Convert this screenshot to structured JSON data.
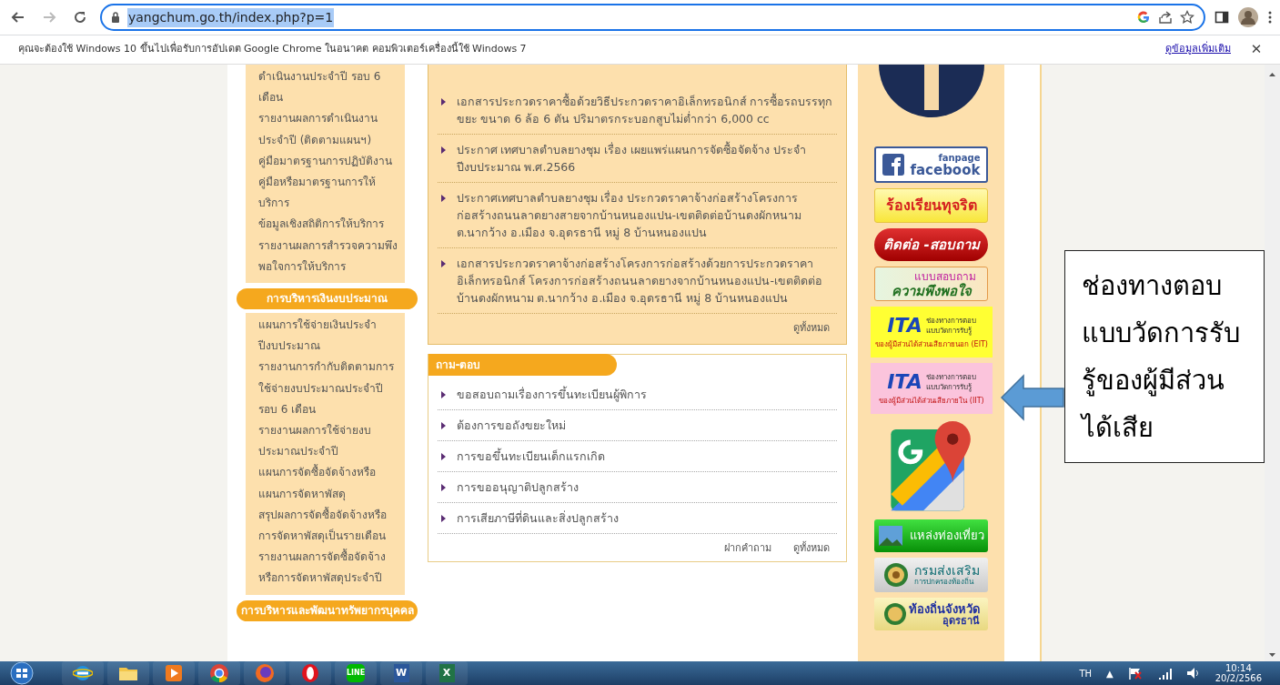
{
  "browser": {
    "back_disabled": false,
    "forward_disabled": true,
    "url": "yangchum.go.th/index.php?p=1",
    "url_selected": true
  },
  "infobar": {
    "message": "คุณจะต้องใช้ Windows 10 ขึ้นไปเพื่อรับการอัปเดต Google Chrome ในอนาคต คอมพิวเตอร์เครื่องนี้ใช้ Windows 7",
    "link": "ดูข้อมูลเพิ่มเติม",
    "close": "✕"
  },
  "left_menu": [
    {
      "items": [
        "ดำเนินงานประจำปี รอบ 6 เดือน",
        "รายงานผลการดำเนินงานประจำปี (ติดตามแผนฯ)",
        "คู่มือมาตรฐานการปฏิบัติงาน",
        "คู่มือหรือมาตรฐานการให้บริการ",
        "ข้อมูลเชิงสถิติการให้บริการ",
        "รายงานผลการสำรวจความพึงพอใจการให้บริการ"
      ]
    },
    {
      "heading": "การบริหารเงินงบประมาณ",
      "items": [
        "แผนการใช้จ่ายเงินประจำปีงบประมาณ",
        "รายงานการกำกับติดตามการใช้จ่ายงบประมาณประจำปี รอบ 6 เดือน",
        "รายงานผลการใช้จ่ายงบประมาณประจำปี",
        "แผนการจัดซื้อจัดจ้างหรือแผนการจัดหาพัสดุ",
        "สรุปผลการจัดซื้อจัดจ้างหรือการจัดหาพัสดุเป็นรายเดือน",
        "รายงานผลการจัดซื้อจัดจ้างหรือการจัดหาพัสดุประจำปี"
      ]
    },
    {
      "heading": "การบริหารและพัฒนาทรัพยากรบุคคล"
    }
  ],
  "news": {
    "items": [
      "เอกสารประกวดราคาซื้อด้วยวิธีประกวดราคาอิเล็กทรอนิกส์ การซื้อรถบรรทุกขยะ ขนาด 6 ล้อ 6 ตัน ปริมาตรกระบอกสูบไม่ต่ำกว่า 6,000 cc",
      "ประกาศ เทศบาลตำบลยางชุม เรื่อง เผยแพร่แผนการจัดซื้อจัดจ้าง ประจำปีงบประมาณ พ.ศ.2566",
      "ประกาศเทศบาลตำบลยางชุม เรื่อง ประกวดราคาจ้างก่อสร้างโครงการก่อสร้างถนนลาดยางสายจากบ้านหนองแปน-เขตติดต่อบ้านดงผักหนาม ต.นากว้าง อ.เมือง จ.อุดรธานี หมู่ 8 บ้านหนองแปน",
      "เอกสารประกวดราคาจ้างก่อสร้างโครงการก่อสร้างด้วยการประกวดราคาอิเล็กทรอนิกส์ โครงการก่อสร้างถนนลาดยางจากบ้านหนองแปน-เขตติดต่อบ้านดงผักหนาม ต.นากว้าง อ.เมือง จ.อุดรธานี หมู่ 8 บ้านหนองแปน"
    ],
    "view_all": "ดูทั้งหมด"
  },
  "qa": {
    "title": "ถาม-ตอบ",
    "items": [
      "ขอสอบถามเรื่องการขึ้นทะเบียนผู้พิการ",
      "ต้องการขอถังขยะใหม่",
      "การขอขึ้นทะเบียนเด็กแรกเกิด",
      "การขออนุญาติปลูกสร้าง",
      "การเสียภาษีที่ดินและสิ่งปลูกสร้าง"
    ],
    "ask": "ฝากคำถาม",
    "view_all": "ดูทั้งหมด"
  },
  "banners": [
    {
      "kind": "fb-circle"
    },
    {
      "kind": "fanpage",
      "lines": [
        "fanpage",
        "facebook"
      ]
    },
    {
      "kind": "report",
      "lines": [
        "ร้องเรียนทุจริต"
      ]
    },
    {
      "kind": "contact",
      "lines": [
        "ติดต่อ -สอบถาม"
      ]
    },
    {
      "kind": "survey",
      "lines": [
        "แบบสอบถาม",
        "ความพึงพอใจ"
      ]
    },
    {
      "kind": "ita",
      "color": "#ffff33",
      "logo": "ITA",
      "lines": [
        "ช่องทางการตอบ",
        "แบบวัดการรับรู้",
        "ของผู้มีส่วนได้ส่วนเสียภายนอก (EIT)"
      ]
    },
    {
      "kind": "ita",
      "color": "#fbc4dc",
      "logo": "ITA",
      "lines": [
        "ช่องทางการตอบ",
        "แบบวัดการรับรู้",
        "ของผู้มีส่วนได้ส่วนเสียภายใน (IIT)"
      ]
    },
    {
      "kind": "maps"
    },
    {
      "kind": "tourism",
      "lines": [
        "แหล่งท่องเที่ยว"
      ]
    },
    {
      "kind": "dept",
      "lines": [
        "กรมส่งเสริม",
        "การปกครองท้องถิ่น"
      ]
    },
    {
      "kind": "province",
      "lines": [
        "ท้องถิ่นจังหวัด",
        "อุดรธานี"
      ]
    }
  ],
  "callout": {
    "text": "ช่องทางตอบแบบวัดการรับรู้ของผู้มีส่วนได้เสีย"
  },
  "taskbar": {
    "apps": [
      {
        "kind": "ie"
      },
      {
        "kind": "folder"
      },
      {
        "kind": "media"
      },
      {
        "kind": "chrome"
      },
      {
        "kind": "firefox"
      },
      {
        "kind": "opera"
      },
      {
        "kind": "line",
        "label": "LINE"
      },
      {
        "kind": "word",
        "label": "W"
      },
      {
        "kind": "excel",
        "label": "X"
      }
    ],
    "language": "TH",
    "tray_toggle": "▲",
    "time": "10:14",
    "date": "20/2/2566"
  }
}
